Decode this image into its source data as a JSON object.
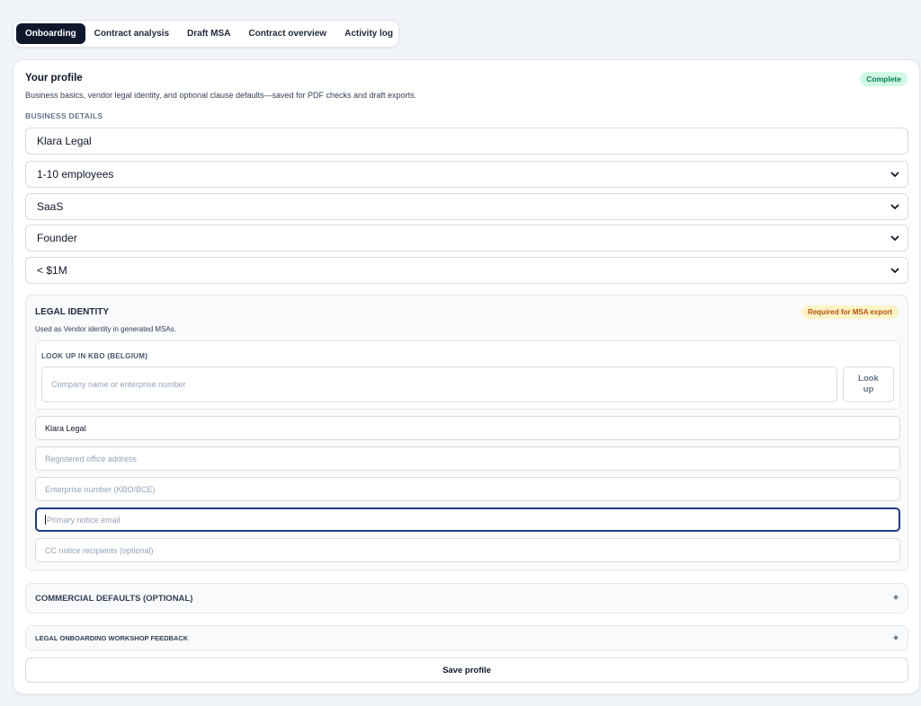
{
  "tabs": [
    {
      "label": "Onboarding",
      "active": true
    },
    {
      "label": "Contract analysis"
    },
    {
      "label": "Draft MSA"
    },
    {
      "label": "Contract overview"
    },
    {
      "label": "Activity log"
    }
  ],
  "profile": {
    "title": "Your profile",
    "subtitle": "Business basics, vendor legal identity, and optional clause defaults—saved for PDF checks and draft exports.",
    "status": "Complete"
  },
  "business": {
    "label": "BUSINESS DETAILS",
    "company_name": "Klara Legal",
    "size": "1-10 employees",
    "industry": "SaaS",
    "role": "Founder",
    "revenue": "< $1M"
  },
  "legal": {
    "title": "LEGAL IDENTITY",
    "subtitle": "Used as Vendor identity in generated MSAs.",
    "badge": "Required for MSA export",
    "lookup": {
      "label": "LOOK UP IN KBO (BELGIUM)",
      "placeholder": "Company name or enterprise number",
      "button": "Look up"
    },
    "legal_name": "Klara Legal",
    "address_placeholder": "Registered office address",
    "enterprise_placeholder": "Enterprise number (KBO/BCE)",
    "email_placeholder": "Primary notice email",
    "cc_placeholder": "CC notice recipients (optional)"
  },
  "commercial": {
    "title": "COMMERCIAL DEFAULTS (OPTIONAL)",
    "toggle": "+"
  },
  "workshop": {
    "title": "LEGAL ONBOARDING WORKSHOP FEEDBACK",
    "toggle": "+"
  },
  "save_label": "Save profile"
}
